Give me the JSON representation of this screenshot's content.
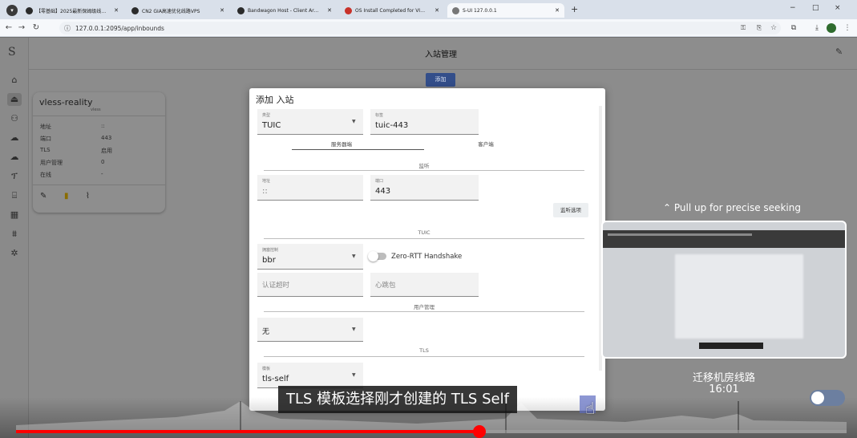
{
  "browser": {
    "tabs": [
      {
        "label": "【零基础】2025最新保姆级线…"
      },
      {
        "label": "CN2 GIA高速优化线路VPS"
      },
      {
        "label": "Bandwagon Host - Client Ar…"
      },
      {
        "label": "OS Install Completed for VI…"
      },
      {
        "label": "S-UI 127.0.0.1"
      }
    ],
    "url": "127.0.0.1:2095/app/inbounds",
    "new_tab": "+",
    "window_controls": [
      "−",
      "□",
      "×"
    ]
  },
  "app": {
    "logo": "S",
    "page_title": "入站管理",
    "add_button": "添加",
    "sidebar_icons": [
      "home-icon",
      "dashboard-icon",
      "users-icon",
      "cloud-icon",
      "cloud-outline-icon",
      "antenna-icon",
      "rules-icon",
      "tiles-icon",
      "tree-icon",
      "settings-icon"
    ]
  },
  "card": {
    "title": "vless-reality",
    "subtitle": "vless",
    "rows": [
      {
        "key": "地址",
        "value": "::"
      },
      {
        "key": "端口",
        "value": "443"
      },
      {
        "key": "TLS",
        "value": "启用"
      },
      {
        "key": "用户管理",
        "value": "0"
      },
      {
        "key": "在线",
        "value": "-"
      }
    ]
  },
  "modal": {
    "title": "添加 入站",
    "type_label": "类型",
    "type_value": "TUIC",
    "tag_label": "标签",
    "tag_value": "tuic-443",
    "tab_server": "服务器端",
    "tab_client": "客户端",
    "listen_section": "监听",
    "addr_label": "地址",
    "addr_value": "::",
    "port_label": "端口",
    "port_value": "443",
    "listen_options_button": "监听选项",
    "tuic_section": "TUIC",
    "congestion_label": "拥塞控制",
    "congestion_value": "bbr",
    "zero_rtt_label": "Zero-RTT Handshake",
    "auth_timeout_placeholder": "认证超时",
    "heartbeat_placeholder": "心跳包",
    "users_section": "用户管理",
    "users_value": "无",
    "tls_section": "TLS",
    "template_label": "模板",
    "template_value": "tls-self",
    "accent": "#3f51b5"
  },
  "video": {
    "seek_hint": "Pull up for precise seeking",
    "chapter_title": "迁移机房线路",
    "chapter_time": "16:01",
    "caption": "TLS 模板选择刚才创建的 TLS Self",
    "progress": 0.558,
    "progress_color": "#ff0000"
  }
}
